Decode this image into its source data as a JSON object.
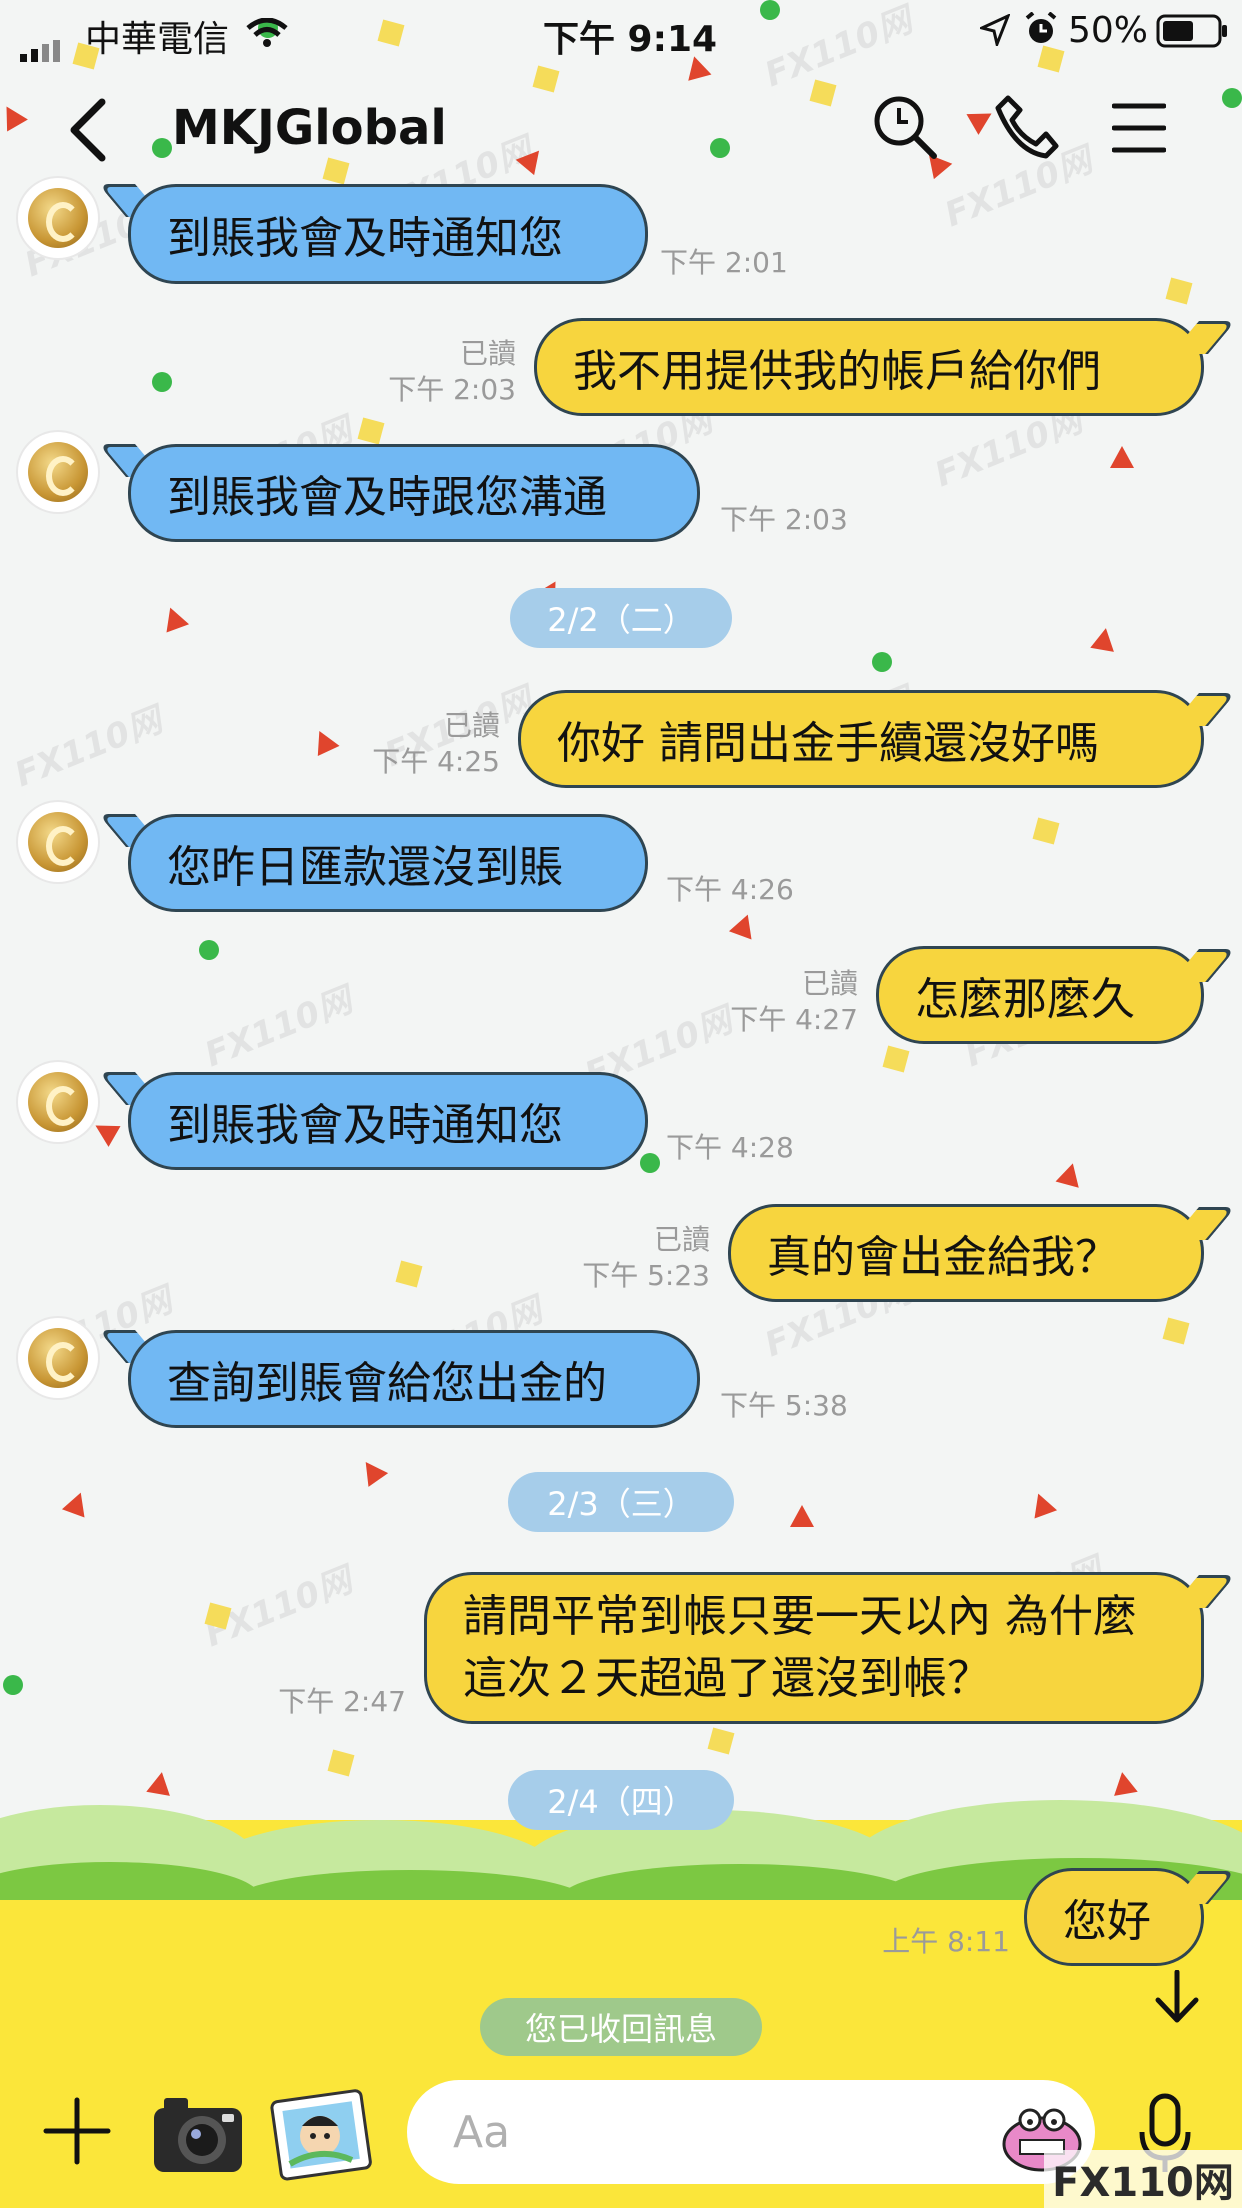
{
  "status_bar": {
    "carrier": "中華電信",
    "time": "下午 9:14",
    "battery": "50%"
  },
  "header": {
    "title": "MKJGlobal",
    "icons": [
      "back-icon",
      "search-icon",
      "phone-icon",
      "menu-icon"
    ]
  },
  "messages": [
    {
      "side": "in",
      "text": "到賬我會及時通知您",
      "time": "下午 2:01"
    },
    {
      "side": "out",
      "text": "我不用提供我的帳戶給你們",
      "read": "已讀",
      "time": "下午 2:03"
    },
    {
      "side": "in",
      "text": "到賬我會及時跟您溝通",
      "time": "下午 2:03"
    },
    {
      "side": "date",
      "text": "2/2（二）"
    },
    {
      "side": "out",
      "text": "你好 請問出金手續還沒好嗎",
      "read": "已讀",
      "time": "下午 4:25"
    },
    {
      "side": "in",
      "text": "您昨日匯款還沒到賬",
      "time": "下午 4:26"
    },
    {
      "side": "out",
      "text": "怎麼那麼久",
      "read": "已讀",
      "time": "下午 4:27"
    },
    {
      "side": "in",
      "text": "到賬我會及時通知您",
      "time": "下午 4:28"
    },
    {
      "side": "out",
      "text": "真的會出金給我？",
      "read": "已讀",
      "time": "下午 5:23"
    },
    {
      "side": "in",
      "text": "查詢到賬會給您出金的",
      "time": "下午 5:38"
    },
    {
      "side": "date",
      "text": "2/3（三）"
    },
    {
      "side": "out",
      "text": "請問平常到帳只要一天以內 為什麼這次２天超過了還沒到帳？",
      "time": "下午 2:47"
    },
    {
      "side": "date",
      "text": "2/4（四）"
    },
    {
      "side": "out",
      "text": "您好",
      "time": "上午 8:11"
    }
  ],
  "recall_notice": "您已收回訊息",
  "input": {
    "placeholder": "Aa"
  },
  "toolbar_icons": [
    "plus-icon",
    "camera-icon",
    "photo-icon",
    "sticker-icon",
    "microphone-icon"
  ],
  "watermark": "FX110网",
  "colors": {
    "incoming_bubble": "#71b8f3",
    "outgoing_bubble": "#f7d53e",
    "date_chip": "#a6cdea",
    "bottom_background": "#fbe63a"
  }
}
